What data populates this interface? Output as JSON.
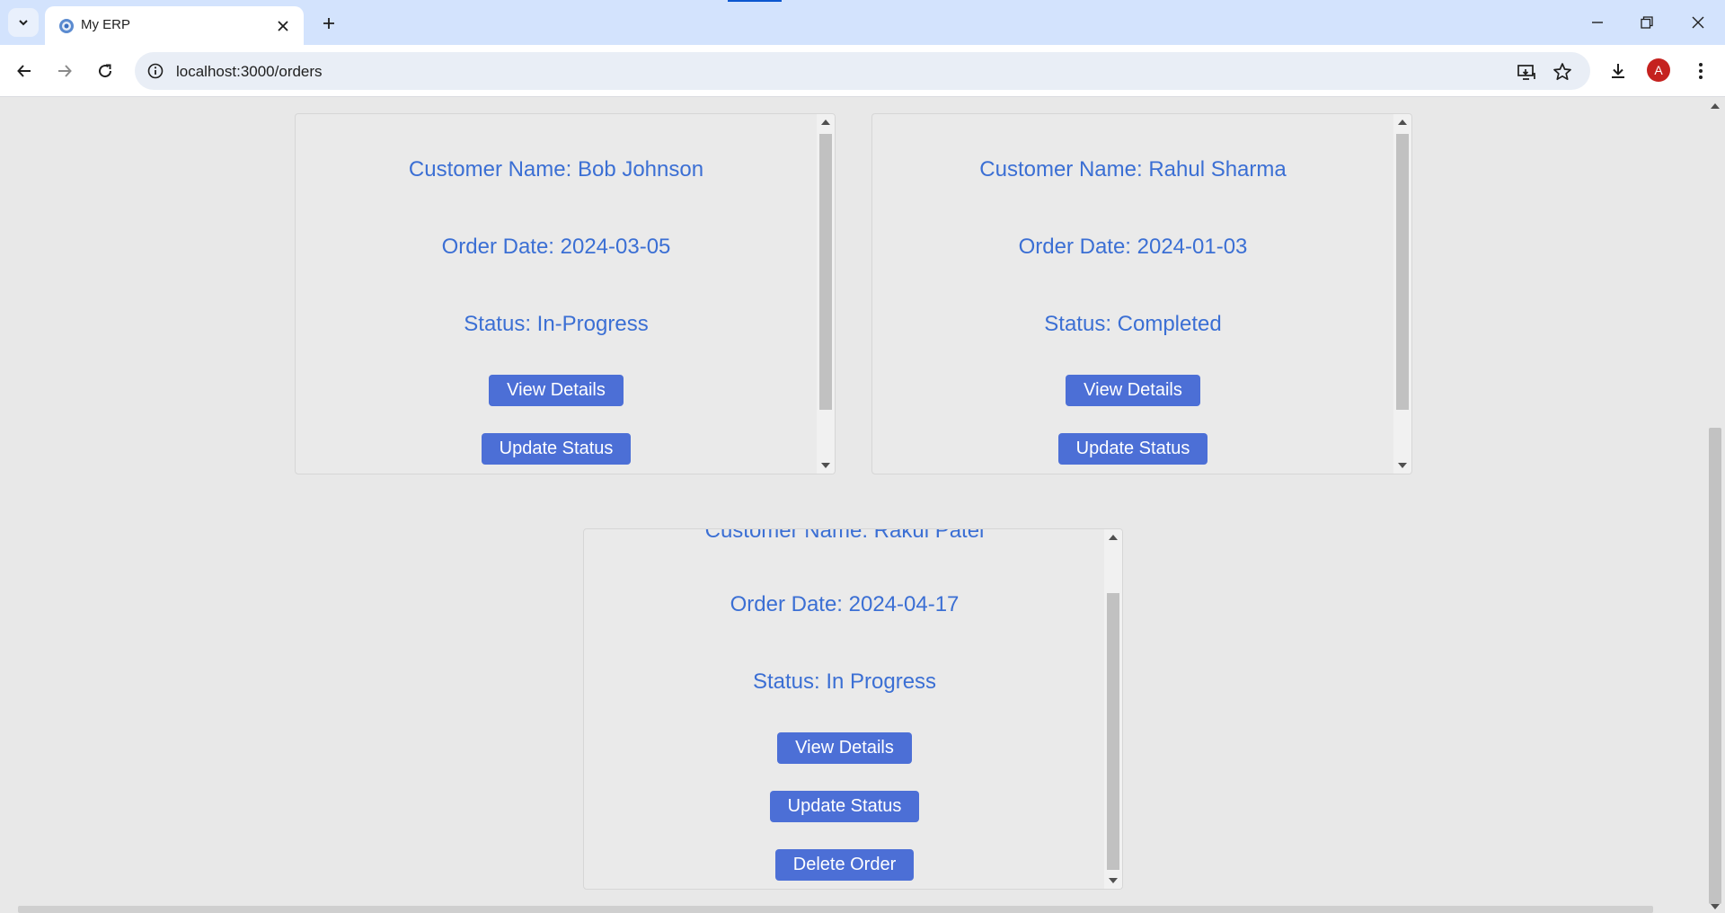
{
  "browser": {
    "tab_title": "My ERP",
    "url": "localhost:3000/orders",
    "avatar_initial": "A"
  },
  "orders": [
    {
      "customer": "Customer Name: Bob Johnson",
      "date": "Order Date: 2024-03-05",
      "status": "Status: In-Progress",
      "view_label": "View Details",
      "update_label": "Update Status"
    },
    {
      "customer": "Customer Name: Rahul Sharma",
      "date": "Order Date: 2024-01-03",
      "status": "Status: Completed",
      "view_label": "View Details",
      "update_label": "Update Status"
    },
    {
      "customer": "Customer Name: Rakul Patel",
      "date": "Order Date: 2024-04-17",
      "status": "Status: In Progress",
      "view_label": "View Details",
      "update_label": "Update Status",
      "delete_label": "Delete Order"
    }
  ],
  "colors": {
    "accent": "#4c6fd6",
    "text_blue": "#3b6fd4",
    "page_bg": "#e8e8e8"
  }
}
